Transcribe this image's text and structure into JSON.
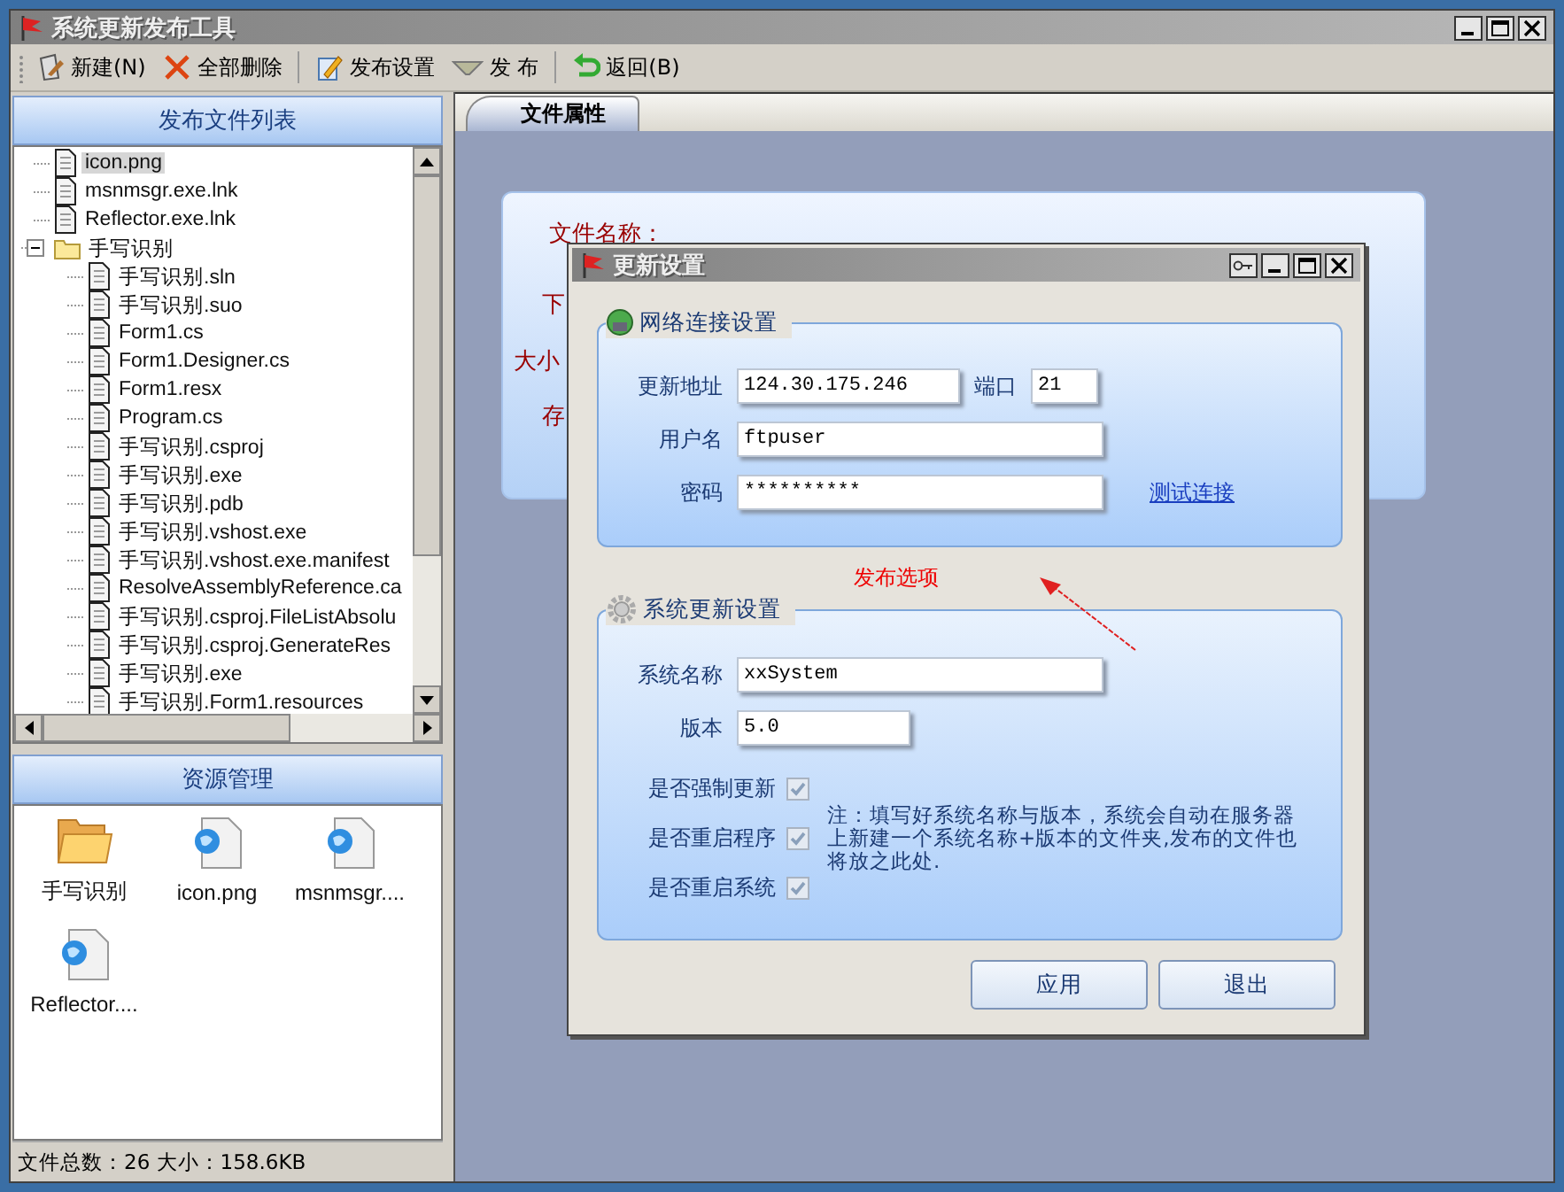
{
  "window": {
    "title": "系统更新发布工具"
  },
  "toolbar": [
    {
      "label": "新建(N)",
      "kind": "new"
    },
    {
      "label": "全部删除",
      "kind": "delete"
    },
    {
      "label": "发布设置",
      "kind": "settings"
    },
    {
      "label": "发 布",
      "kind": "publish"
    },
    {
      "label": "返回(B)",
      "kind": "back"
    }
  ],
  "file_list": {
    "title": "发布文件列表",
    "tree": [
      {
        "label": "icon.png",
        "kind": "file",
        "selected": true
      },
      {
        "label": "msnmsgr.exe.lnk",
        "kind": "file",
        "selected": false
      },
      {
        "label": "Reflector.exe.lnk",
        "kind": "file",
        "selected": false
      },
      {
        "label": "手写识别",
        "kind": "folder",
        "selected": false,
        "expanded": true,
        "children": [
          {
            "label": "手写识别.sln",
            "kind": "file",
            "selected": false
          },
          {
            "label": "手写识别.suo",
            "kind": "file",
            "selected": false
          },
          {
            "label": "Form1.cs",
            "kind": "file",
            "selected": false
          },
          {
            "label": "Form1.Designer.cs",
            "kind": "file",
            "selected": false
          },
          {
            "label": "Form1.resx",
            "kind": "file",
            "selected": false
          },
          {
            "label": "Program.cs",
            "kind": "file",
            "selected": false
          },
          {
            "label": "手写识别.csproj",
            "kind": "file",
            "selected": false
          },
          {
            "label": "手写识别.exe",
            "kind": "file",
            "selected": false
          },
          {
            "label": "手写识别.pdb",
            "kind": "file",
            "selected": false
          },
          {
            "label": "手写识别.vshost.exe",
            "kind": "file",
            "selected": false
          },
          {
            "label": "手写识别.vshost.exe.manifest",
            "kind": "file",
            "selected": false
          },
          {
            "label": "ResolveAssemblyReference.ca",
            "kind": "file",
            "selected": false
          },
          {
            "label": "手写识别.csproj.FileListAbsolu",
            "kind": "file",
            "selected": false
          },
          {
            "label": "手写识别.csproj.GenerateRes",
            "kind": "file",
            "selected": false
          },
          {
            "label": "手写识别.exe",
            "kind": "file",
            "selected": false
          },
          {
            "label": "手写识别.Form1.resources",
            "kind": "file",
            "selected": false
          }
        ]
      }
    ]
  },
  "resources": {
    "title": "资源管理",
    "items": [
      {
        "label": "手写识别",
        "kind": "folder"
      },
      {
        "label": "icon.png",
        "kind": "file"
      },
      {
        "label": "msnmsgr....",
        "kind": "file"
      },
      {
        "label": "Reflector....",
        "kind": "file"
      }
    ]
  },
  "status_bar": "文件总数：26 大小：158.6KB",
  "tabs": [
    {
      "label": "文件属性",
      "selected": true
    }
  ],
  "file_properties": {
    "labels": [
      "文件名称：",
      "下",
      "大小",
      "存"
    ]
  },
  "dialog": {
    "title": "更新设置",
    "network": {
      "title": "网络连接设置",
      "address": {
        "label": "更新地址",
        "value": "124.30.175.246"
      },
      "port": {
        "label": "端口",
        "value": "21"
      },
      "username": {
        "label": "用户名",
        "value": "ftpuser"
      },
      "password": {
        "label": "密码",
        "value": "**********"
      },
      "test_link": "测试连接"
    },
    "system": {
      "title": "系统更新设置",
      "name": {
        "label": "系统名称",
        "value": "xxSystem"
      },
      "version": {
        "label": "版本",
        "value": "5.0"
      },
      "options": [
        {
          "label": "是否强制更新",
          "checked": true,
          "disabled": true
        },
        {
          "label": "是否重启程序",
          "checked": true,
          "disabled": true
        },
        {
          "label": "是否重启系统",
          "checked": true,
          "disabled": true
        }
      ],
      "note": "注：填写好系统名称与版本，系统会自动在服务器上新建一个系统名称+版本的文件夹,发布的文件也将放之此处."
    },
    "buttons": [
      "应用",
      "退出"
    ]
  },
  "annotation": {
    "text": "发布选项"
  }
}
